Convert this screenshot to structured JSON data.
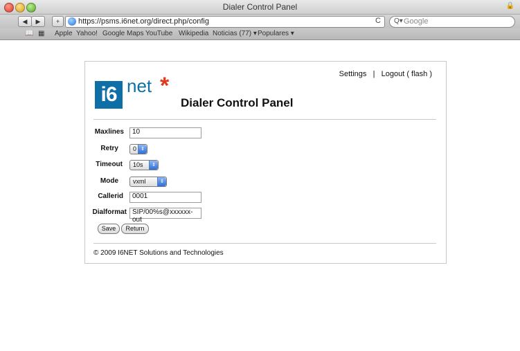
{
  "window": {
    "title": "Dialer Control Panel"
  },
  "toolbar": {
    "back": "◀",
    "forward": "▶",
    "add": "+",
    "url": "https://psms.i6net.org/direct.php/config",
    "reload": "C",
    "search_placeholder": "Google"
  },
  "bookmarks": {
    "items": [
      "Apple",
      "Yahoo!",
      "Google Maps",
      "YouTube",
      "Wikipedia",
      "Noticias (77) ▾",
      "Populares ▾"
    ]
  },
  "header": {
    "logo_mark": "i6",
    "logo_text": "net",
    "logo_star": "*",
    "settings_link": "Settings",
    "separator": "|",
    "logout_link": "Logout ( flash )",
    "title": "Dialer Control Panel"
  },
  "form": {
    "maxlines": {
      "label": "Maxlines",
      "value": "10"
    },
    "retry": {
      "label": "Retry",
      "value": "0"
    },
    "timeout": {
      "label": "Timeout",
      "value": "10s"
    },
    "mode": {
      "label": "Mode",
      "value": "vxml"
    },
    "callerid": {
      "label": "Callerid",
      "value": "0001"
    },
    "dialformat": {
      "label": "Dialformat",
      "value": "SIP/00%s@xxxxxx-out"
    },
    "save_label": "Save",
    "return_label": "Return"
  },
  "footer": {
    "text": "© 2009 I6NET Solutions and Technologies"
  },
  "colors": {
    "brand_blue": "#0e6fa6",
    "brand_star": "#e03a1c"
  }
}
